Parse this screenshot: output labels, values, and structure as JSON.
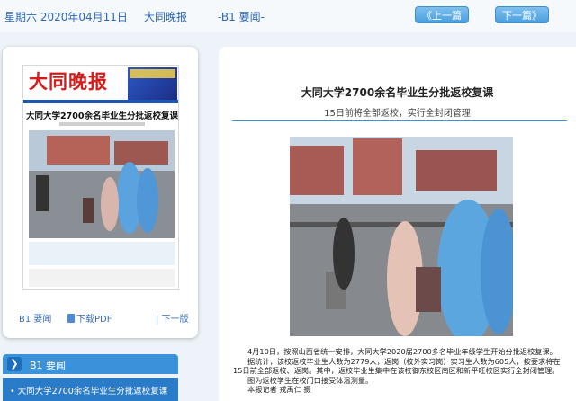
{
  "topbar": {
    "date": "星期六 2020年04月11日",
    "paper_name": "大同晚报",
    "page": "-B1 要闻-",
    "prev_label": "《上一篇",
    "next_label": "下一篇》"
  },
  "thumbnail": {
    "masthead": "大同晚报",
    "headline": "大同大学2700余名毕业生分批返校复课",
    "links": {
      "page": "B1 要闻",
      "pdf": "下载PDF",
      "next": "| 下一版"
    }
  },
  "sections": {
    "head_label": "B1  要闻",
    "items": [
      {
        "label": "• 大同大学2700余名毕业生分批返校复课"
      }
    ]
  },
  "article": {
    "title": "大同大学2700余名毕业生分批返校复课",
    "subtitle": "15日前将全部返校，实行全封闭管理",
    "paragraphs": [
      "4月10日，按照山西省统一安排，大同大学2020届2700多名毕业年级学生开始分批返校复课。",
      "据统计，该校返校毕业生人数为2779人，返岗（校外实习岗）实习生人数为605人，按要求将在15日前全部返校、返岗。其中，返校毕业生集中在该校御东校区南区和新平旺校区实行全封闭管理。",
      "图为返校学生在校门口接受体温测量。",
      "本报记者 戎禹仁 摄"
    ]
  },
  "colors": {
    "accent": "#3a93da",
    "masthead_red": "#d61b1b",
    "link": "#2a67b8"
  }
}
